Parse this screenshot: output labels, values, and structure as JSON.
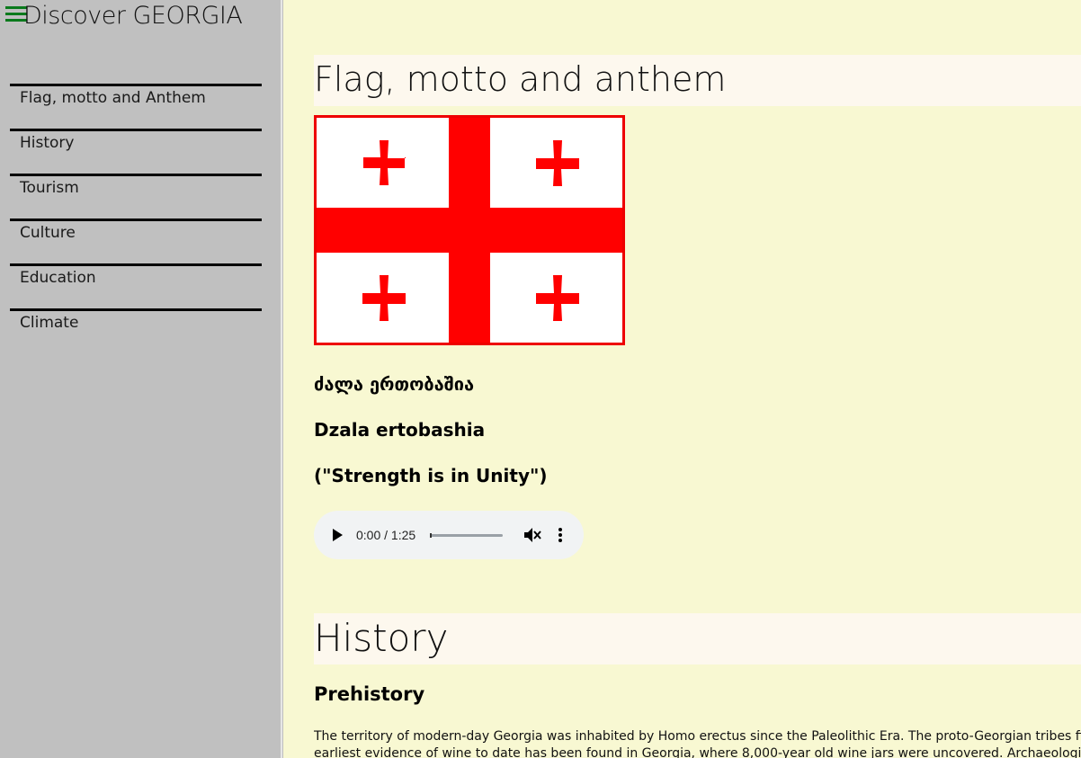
{
  "sidebar": {
    "brand": "Discover GEORGIA",
    "menu_icon": "hamburger-icon",
    "items": [
      {
        "label": "Flag, motto and Anthem"
      },
      {
        "label": "History"
      },
      {
        "label": "Tourism"
      },
      {
        "label": "Culture"
      },
      {
        "label": "Education"
      },
      {
        "label": "Climate"
      }
    ]
  },
  "flag_section": {
    "title": "Flag, motto and anthem",
    "flag": {
      "field_color": "#ffffff",
      "cross_color": "#ff0000",
      "border_color": "#ee0000"
    },
    "motto_georgian": "ძალა ერთობაშია",
    "motto_latin": "Dzala ertobashia",
    "motto_english": "(\"Strength is in Unity\")",
    "audio": {
      "time": "0:00 / 1:25",
      "play_icon": "play-icon",
      "mute_icon": "muted-speaker-icon",
      "more_icon": "more-vertical-icon"
    }
  },
  "history_section": {
    "title": "History",
    "subheading": "Prehistory",
    "text_line1": "The territory of modern-day Georgia was inhabited by Homo erectus since the Paleolithic Era. The proto-Georgian tribes first appear",
    "text_line2": "earliest evidence of wine to date has been found in Georgia, where 8,000-year old wine jars were uncovered. Archaeological finds and"
  },
  "colors": {
    "sidebar_bg": "#c0c0c0",
    "page_bg": "#f8f8d2",
    "heading_bg": "#fdf8ee",
    "menu_icon": "#0a7a1c"
  }
}
